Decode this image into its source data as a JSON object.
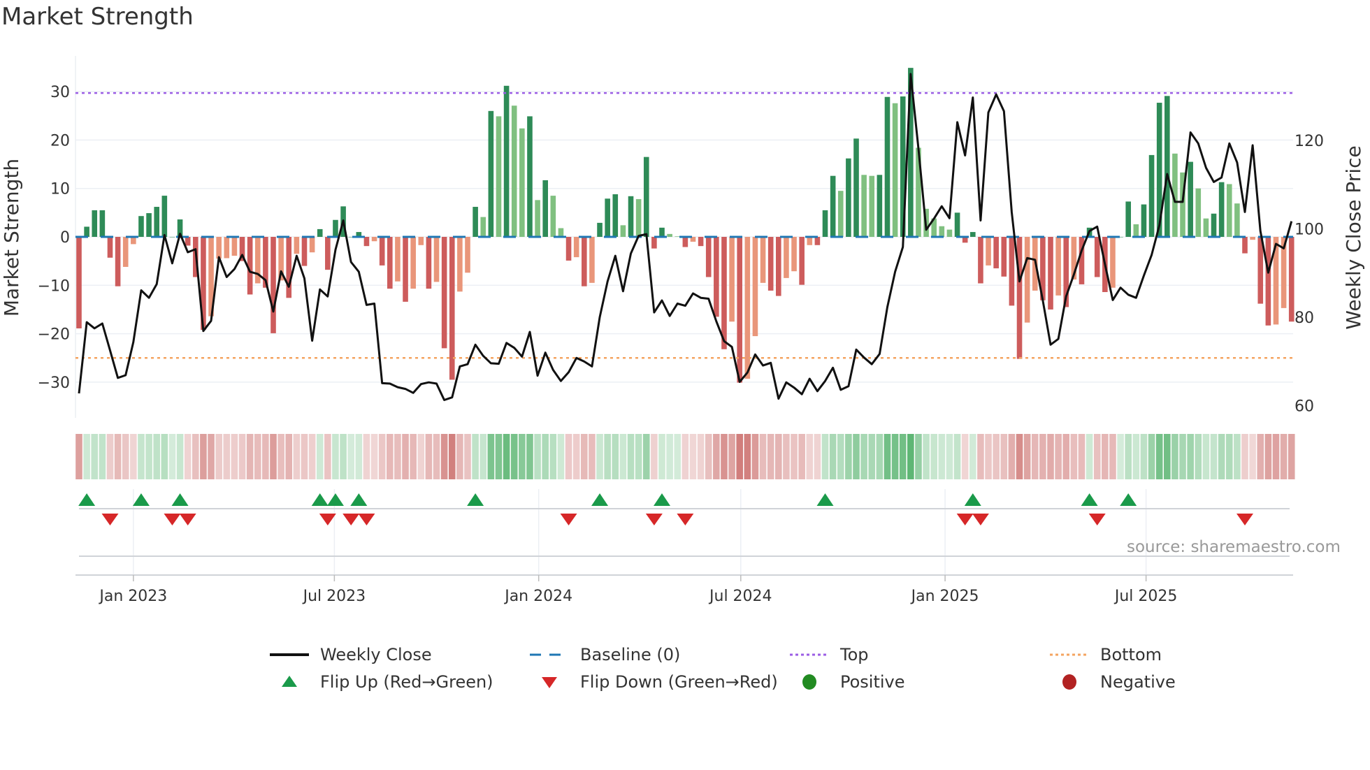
{
  "title": "Market Strength",
  "source": "source: sharemaestro.com",
  "legend": {
    "weekly_close": "Weekly Close",
    "baseline": "Baseline (0)",
    "top": "Top",
    "bottom": "Bottom",
    "flip_up": "Flip Up (Red→Green)",
    "flip_down": "Flip Down (Green→Red)",
    "positive": "Positive",
    "negative": "Negative"
  },
  "colors": {
    "pos_dark": "#2e8b57",
    "pos_light": "#80c080",
    "neg_dark": "#cd5c5c",
    "neg_light": "#e9967a",
    "top": "#9b5de5",
    "bottom": "#f4a460",
    "baseline": "#1f77b4",
    "line": "#111111",
    "flip_up": "#1a9a4a",
    "flip_down": "#d62728",
    "positive": "#228b22",
    "negative": "#b22222"
  },
  "chart_data": {
    "type": "bar+line",
    "title": "Market Strength",
    "ylabel": "Market Strength",
    "y2label": "Weekly Close Price",
    "ylim": [
      -37,
      37
    ],
    "y2lim": [
      58,
      140
    ],
    "yticks": [
      "30",
      "20",
      "10",
      "0",
      "−10",
      "−20",
      "−30"
    ],
    "ytick_values": [
      30,
      20,
      10,
      0,
      -10,
      -20,
      -30
    ],
    "y2ticks": [
      "120",
      "100",
      "80",
      "60"
    ],
    "y2tick_values": [
      120,
      100,
      80,
      60
    ],
    "xticks": [
      "Jan 2023",
      "Jul 2023",
      "Jan 2024",
      "Jul 2024",
      "Jan 2025",
      "Jul 2025"
    ],
    "xtick_dates": [
      "2023-01-01",
      "2023-07-01",
      "2024-01-01",
      "2024-07-01",
      "2025-01-01",
      "2025-07-01"
    ],
    "start_date": "2022-11-13",
    "frequency_days": 7,
    "top_level": 29.7,
    "bottom_level": -25,
    "baseline": 0,
    "strength": [
      -18.9,
      2.1,
      5.5,
      5.5,
      -4.3,
      -10.2,
      -6.2,
      -1.5,
      4.3,
      4.9,
      6.2,
      8.5,
      0,
      3.6,
      -1.8,
      -8.3,
      -19.2,
      -16.4,
      -4.5,
      -4.4,
      -3.9,
      -5,
      -11.9,
      -9.6,
      -10.5,
      -19.9,
      -9,
      -12.6,
      -3.5,
      -6,
      -3.2,
      1.6,
      -6.8,
      3.5,
      6.3,
      0,
      1,
      -1.9,
      -0.9,
      -5.9,
      -10.7,
      -9.2,
      -13.4,
      -10.7,
      -1.7,
      -10.7,
      -9.3,
      -23,
      -29.5,
      -11.3,
      -7.4,
      6.2,
      4.1,
      26,
      24.9,
      31.2,
      27.1,
      22.4,
      24.9,
      7.6,
      11.7,
      8.5,
      1.8,
      -4.9,
      -4.2,
      -10.2,
      -9.5,
      2.9,
      7.9,
      8.8,
      2.4,
      8.4,
      7.8,
      16.5,
      -2.4,
      1.9,
      0.6,
      0.1,
      -2.1,
      -1,
      -1.9,
      -8.3,
      -16.5,
      -23.2,
      -17.5,
      -30.1,
      -29.3,
      -20.5,
      -9.5,
      -11.1,
      -12.2,
      -8.5,
      -7.1,
      -9.9,
      -1.7,
      -1.7,
      5.5,
      12.6,
      9.5,
      16.2,
      20.3,
      12.8,
      12.6,
      12.8,
      28.9,
      27.6,
      29,
      34.9,
      18.4,
      5.8,
      3.8,
      2.2,
      1.5,
      5,
      -1.2,
      1,
      -9.6,
      -5.9,
      -6.5,
      -8.2,
      -14.2,
      -25.2,
      -17.7,
      -11.1,
      -13.1,
      -15,
      -12.1,
      -14.5,
      -8.8,
      -9.8,
      1.9,
      -8.3,
      -11.4,
      -10.5,
      0,
      7.3,
      2.6,
      6.7,
      16.9,
      27.7,
      29.1,
      17.2,
      13.3,
      15.5,
      10,
      3.8,
      4.8,
      11.3,
      10.9,
      6.9,
      -3.4,
      -0.6,
      -13.8,
      -18.3,
      -18.1,
      -14.7,
      -17.5
    ],
    "weekly_close": [
      62.8,
      78.9,
      77.5,
      78.6,
      72.5,
      66.3,
      66.9,
      74.4,
      86.1,
      84.4,
      87.5,
      98.6,
      92.2,
      98.9,
      94.7,
      95.4,
      76.9,
      79.2,
      93.6,
      89.1,
      90.9,
      94.1,
      90.3,
      89.8,
      88.4,
      81.3,
      90.4,
      86.9,
      93.9,
      88.8,
      74.7,
      86.3,
      84.7,
      95.3,
      101.9,
      92.5,
      90.3,
      82.8,
      83.1,
      65.1,
      65,
      64.2,
      63.8,
      62.9,
      64.9,
      65.3,
      65,
      61.3,
      61.9,
      68.9,
      69.4,
      73.8,
      71.3,
      69.6,
      69.5,
      74.2,
      73.1,
      71.1,
      76.7,
      66.8,
      72,
      68.1,
      65.6,
      67.6,
      70.8,
      70,
      68.9,
      80,
      88.1,
      93.9,
      85.9,
      94.4,
      98.4,
      98.8,
      81.1,
      83.8,
      80.3,
      83.1,
      82.6,
      85.4,
      84.4,
      84.2,
      79.1,
      74.6,
      73.3,
      65.4,
      67.5,
      71.6,
      69.1,
      69.7,
      61.6,
      65.3,
      64.1,
      62.6,
      66.1,
      63.3,
      65.6,
      68.6,
      63.6,
      64.4,
      72.7,
      70.9,
      69.4,
      71.7,
      82.3,
      90.3,
      95.9,
      135,
      118.1,
      99.8,
      102.3,
      105.1,
      102.4,
      124.1,
      116.6,
      129.7,
      101.9,
      126.3,
      130.4,
      126.6,
      103.8,
      88.1,
      93.4,
      93,
      83.8,
      73.8,
      75.1,
      84.7,
      89.7,
      95.1,
      99.5,
      100.5,
      92,
      83.9,
      86.7,
      85.1,
      84.4,
      89.4,
      94.1,
      100.8,
      112.4,
      106.1,
      106.1,
      121.8,
      119.3,
      113.8,
      110.6,
      111.6,
      119.3,
      115,
      103.8,
      118.9,
      99.5,
      90.1,
      96.6,
      95.6,
      101.7
    ],
    "flip_up_dates": [
      "2022-11-20",
      "2023-01-08",
      "2023-02-12",
      "2023-06-18",
      "2023-07-02",
      "2023-07-23",
      "2023-11-05",
      "2024-02-25",
      "2024-04-21",
      "2024-09-15",
      "2025-01-26",
      "2025-05-11",
      "2025-06-15"
    ],
    "flip_down_dates": [
      "2022-12-11",
      "2023-02-05",
      "2023-02-19",
      "2023-06-25",
      "2023-07-16",
      "2023-07-30",
      "2024-01-28",
      "2024-04-14",
      "2024-05-12",
      "2025-01-19",
      "2025-02-02",
      "2025-05-18",
      "2025-09-28"
    ]
  }
}
